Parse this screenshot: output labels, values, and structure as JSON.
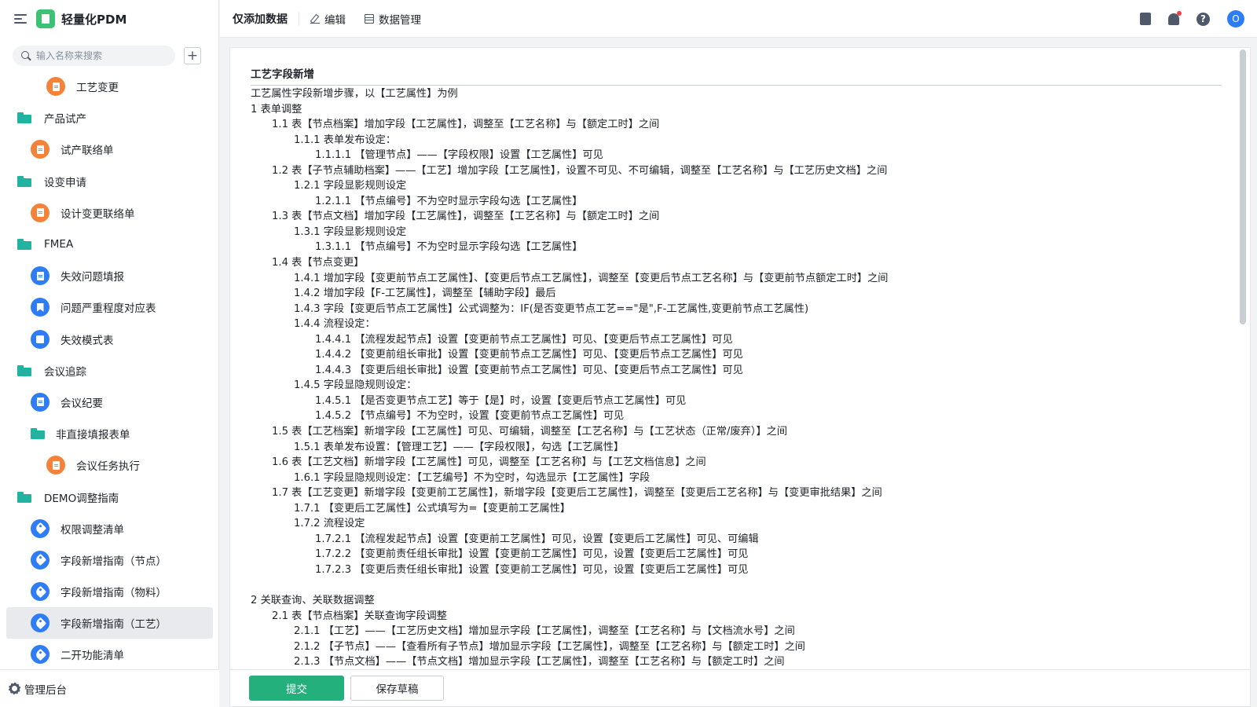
{
  "app": {
    "title": "轻量化PDM"
  },
  "search": {
    "placeholder": "输入名称来搜索"
  },
  "sidebar": {
    "items": [
      {
        "label": "工艺变更",
        "level": 2,
        "icon": "orange-doc-icon"
      },
      {
        "label": "产品试产",
        "level": 0,
        "icon": "folder-icon"
      },
      {
        "label": "试产联络单",
        "level": 1,
        "icon": "orange-doc-icon"
      },
      {
        "label": "设变申请",
        "level": 0,
        "icon": "folder-icon"
      },
      {
        "label": "设计变更联络单",
        "level": 1,
        "icon": "orange-doc-icon"
      },
      {
        "label": "FMEA",
        "level": 0,
        "icon": "folder-icon"
      },
      {
        "label": "失效问题填报",
        "level": 1,
        "icon": "blue-doc-icon"
      },
      {
        "label": "问题严重程度对应表",
        "level": 1,
        "icon": "bookmark-icon"
      },
      {
        "label": "失效模式表",
        "level": 1,
        "icon": "table-icon"
      },
      {
        "label": "会议追踪",
        "level": 0,
        "icon": "folder-icon"
      },
      {
        "label": "会议纪要",
        "level": 1,
        "icon": "blue-doc-icon"
      },
      {
        "label": "非直接填报表单",
        "level": 1,
        "icon": "folder-icon"
      },
      {
        "label": "会议任务执行",
        "level": 2,
        "icon": "orange-doc-icon"
      },
      {
        "label": "DEMO调整指南",
        "level": 0,
        "icon": "folder-icon"
      },
      {
        "label": "权限调整清单",
        "level": 1,
        "icon": "tag-icon"
      },
      {
        "label": "字段新增指南（节点）",
        "level": 1,
        "icon": "tag-icon"
      },
      {
        "label": "字段新增指南（物料）",
        "level": 1,
        "icon": "tag-icon"
      },
      {
        "label": "字段新增指南（工艺）",
        "level": 1,
        "icon": "tag-icon",
        "active": true
      },
      {
        "label": "二开功能清单",
        "level": 1,
        "icon": "tag-icon"
      }
    ],
    "admin_label": "管理后台"
  },
  "topbar": {
    "title": "仅添加数据",
    "edit_label": "编辑",
    "data_mgmt_label": "数据管理",
    "help_glyph": "?",
    "avatar_initial": "O"
  },
  "document": {
    "title": "工艺字段新增",
    "lines": [
      {
        "indent": 0,
        "text": "工艺属性字段新增步骤，以【工艺属性】为例"
      },
      {
        "indent": 0,
        "text": "1    表单调整"
      },
      {
        "indent": 1,
        "text": "1.1    表【节点档案】增加字段【工艺属性】，调整至【工艺名称】与【额定工时】之间"
      },
      {
        "indent": 2,
        "text": "1.1.1  表单发布设定："
      },
      {
        "indent": 3,
        "text": "1.1.1.1  【管理节点】——【字段权限】设置【工艺属性】可见"
      },
      {
        "indent": 1,
        "text": "1.2    表【子节点辅助档案】——【工艺】增加字段【工艺属性】，设置不可见、不可编辑，调整至【工艺名称】与【工艺历史文档】之间"
      },
      {
        "indent": 2,
        "text": "1.2.1  字段显影规则设定"
      },
      {
        "indent": 3,
        "text": "1.2.1.1  【节点编号】不为空时显示字段勾选【工艺属性】"
      },
      {
        "indent": 1,
        "text": "1.3    表【节点文档】增加字段【工艺属性】，调整至【工艺名称】与【额定工时】之间"
      },
      {
        "indent": 2,
        "text": "1.3.1  字段显影规则设定"
      },
      {
        "indent": 3,
        "text": "1.3.1.1  【节点编号】不为空时显示字段勾选【工艺属性】"
      },
      {
        "indent": 1,
        "text": "1.4    表【节点变更】"
      },
      {
        "indent": 2,
        "text": "1.4.1  增加字段【变更前节点工艺属性】、【变更后节点工艺属性】，调整至【变更后节点工艺名称】与【变更前节点额定工时】之间"
      },
      {
        "indent": 2,
        "text": "1.4.2  增加字段【F-工艺属性】，调整至【辅助字段】最后"
      },
      {
        "indent": 2,
        "text": "1.4.3  字段【变更后节点工艺属性】公式调整为：IF(是否变更节点工艺==\"是\",F-工艺属性,变更前节点工艺属性)"
      },
      {
        "indent": 2,
        "text": "1.4.4  流程设定："
      },
      {
        "indent": 3,
        "text": "1.4.4.1  【流程发起节点】设置【变更前节点工艺属性】可见、【变更后节点工艺属性】可见"
      },
      {
        "indent": 3,
        "text": "1.4.4.2  【变更前组长审批】设置【变更前节点工艺属性】可见、【变更后节点工艺属性】可见"
      },
      {
        "indent": 3,
        "text": "1.4.4.3  【变更后组长审批】设置【变更前节点工艺属性】可见、【变更后节点工艺属性】可见"
      },
      {
        "indent": 2,
        "text": "1.4.5  字段显隐规则设定："
      },
      {
        "indent": 3,
        "text": "1.4.5.1  【是否变更节点工艺】等于【是】时，设置【变更后节点工艺属性】可见"
      },
      {
        "indent": 3,
        "text": "1.4.5.2  【节点编号】不为空时，设置【变更前节点工艺属性】可见"
      },
      {
        "indent": 1,
        "text": "1.5    表【工艺档案】新增字段【工艺属性】可见、可编辑，调整至【工艺名称】与【工艺状态（正常/废弃）】之间"
      },
      {
        "indent": 2,
        "text": "1.5.1  表单发布设置：【管理工艺】——【字段权限】，勾选【工艺属性】"
      },
      {
        "indent": 1,
        "text": "1.6    表【工艺文档】新增字段【工艺属性】可见，调整至【工艺名称】与【工艺文档信息】之间"
      },
      {
        "indent": 2,
        "text": "1.6.1  字段显隐规则设定：【工艺编号】不为空时，勾选显示【工艺属性】字段"
      },
      {
        "indent": 1,
        "text": "1.7    表【工艺变更】新增字段【变更前工艺属性】，新增字段【变更后工艺属性】，调整至【变更后工艺名称】与【变更审批结果】之间"
      },
      {
        "indent": 2,
        "text": "1.7.1  【变更后工艺属性】公式填写为=【变更前工艺属性】"
      },
      {
        "indent": 2,
        "text": "1.7.2  流程设定"
      },
      {
        "indent": 3,
        "text": "1.7.2.1  【流程发起节点】设置【变更前工艺属性】可见，设置【变更后工艺属性】可见、可编辑"
      },
      {
        "indent": 3,
        "text": "1.7.2.2  【变更前责任组长审批】设置【变更前工艺属性】可见，设置【变更后工艺属性】可见"
      },
      {
        "indent": 3,
        "text": "1.7.2.3  【变更后责任组长审批】设置【变更前工艺属性】可见，设置【变更后工艺属性】可见"
      },
      {
        "indent": 0,
        "text": ""
      },
      {
        "indent": 0,
        "text": "2    关联查询、关联数据调整"
      },
      {
        "indent": 1,
        "text": "2.1    表【节点档案】关联查询字段调整"
      },
      {
        "indent": 2,
        "text": "2.1.1  【工艺】——【工艺历史文档】增加显示字段【工艺属性】，调整至【工艺名称】与【文档流水号】之间"
      },
      {
        "indent": 2,
        "text": "2.1.2  【子节点】——【查看所有子节点】增加显示字段【工艺属性】，调整至【工艺名称】与【额定工时】之间"
      },
      {
        "indent": 2,
        "text": "2.1.3  【节点文档】——【节点文档】增加显示字段【工艺属性】，调整至【工艺名称】与【额定工时】之间"
      }
    ]
  },
  "footer": {
    "submit_label": "提交",
    "draft_label": "保存草稿"
  },
  "colors": {
    "primary": "#23b07d",
    "accent_blue": "#2f7df6",
    "accent_orange": "#f3833a",
    "folder": "#20b3a0"
  }
}
